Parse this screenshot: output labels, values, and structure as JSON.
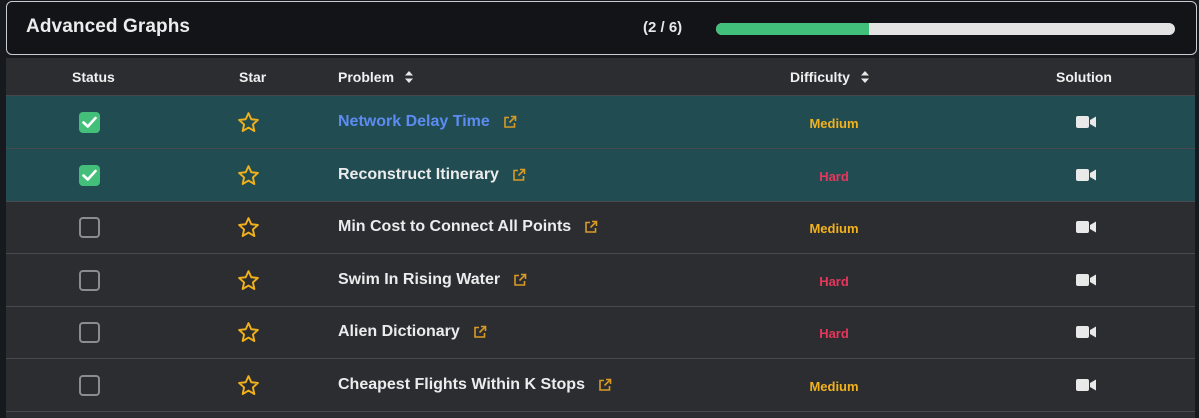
{
  "section": {
    "title": "Advanced Graphs",
    "progress_text": "(2 / 6)",
    "progress_fraction": 0.333,
    "accent_color": "#41c07c"
  },
  "table": {
    "headers": {
      "status": "Status",
      "star": "Star",
      "problem": "Problem",
      "difficulty": "Difficulty",
      "solution": "Solution"
    },
    "rows": [
      {
        "completed": true,
        "name": "Network Delay Time",
        "difficulty": "Medium",
        "highlighted_link": true
      },
      {
        "completed": true,
        "name": "Reconstruct Itinerary",
        "difficulty": "Hard",
        "highlighted_link": false
      },
      {
        "completed": false,
        "name": "Min Cost to Connect All Points",
        "difficulty": "Medium",
        "highlighted_link": false
      },
      {
        "completed": false,
        "name": "Swim In Rising Water",
        "difficulty": "Hard",
        "highlighted_link": false
      },
      {
        "completed": false,
        "name": "Alien Dictionary",
        "difficulty": "Hard",
        "highlighted_link": false
      },
      {
        "completed": false,
        "name": "Cheapest Flights Within K Stops",
        "difficulty": "Medium",
        "highlighted_link": false
      }
    ],
    "icons": {
      "status": "checkbox-icon",
      "star": "star-outline-icon",
      "external": "external-link-icon",
      "solution": "video-camera-icon",
      "sort": "sort-icon"
    },
    "colors": {
      "completed_row": "#214c52",
      "medium": "#f3b21c",
      "hard": "#e8365c",
      "star": "#f2b11b",
      "link": "#5c8cf2"
    }
  }
}
